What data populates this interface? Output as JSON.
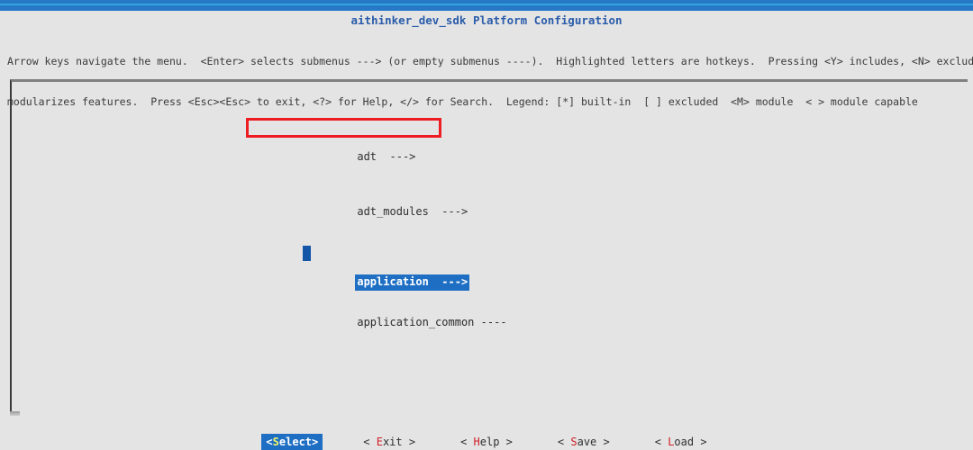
{
  "window": {
    "title": "aithinker_dev_sdk Platform Configuration",
    "top_bar_color": "#2878c8",
    "top_stripe_color": "#35a5dd",
    "background_color": "#e4e4e4",
    "title_color": "#2a5caa"
  },
  "help": {
    "line1": "Arrow keys navigate the menu.  <Enter> selects submenus ---> (or empty submenus ----).  Highlighted letters are hotkeys.  Pressing <Y> includes, <N> excludes, <M>",
    "line2": "modularizes features.  Press <Esc><Esc> to exit, <?> for Help, </> for Search.  Legend: [*] built-in  [ ] excluded  <M> module  < > module capable"
  },
  "menu": {
    "items": [
      {
        "label": "adt",
        "suffix": "--->",
        "selected": false
      },
      {
        "label": "adt_modules",
        "suffix": "--->",
        "selected": false
      },
      {
        "label": "application",
        "suffix": "--->",
        "selected": true,
        "hotkey": "a"
      },
      {
        "label": "application_common",
        "suffix": "----",
        "selected": false
      }
    ],
    "selected_index": 2,
    "highlight_color": "#1e6fc4",
    "cursor_color": "#1455a8",
    "hotkey_color": "#f3f36a"
  },
  "annotation": {
    "shape": "rectangle",
    "color": "#ee1c23",
    "targets": "application"
  },
  "buttons": [
    {
      "text_prefix": "<",
      "hotkey": "S",
      "rest": "elect>",
      "text_suffix": "",
      "active": true
    },
    {
      "text_prefix": "< ",
      "hotkey": "E",
      "rest": "xit",
      "text_suffix": " >",
      "active": false
    },
    {
      "text_prefix": "< ",
      "hotkey": "H",
      "rest": "elp",
      "text_suffix": " >",
      "active": false
    },
    {
      "text_prefix": "< ",
      "hotkey": "S",
      "rest": "ave",
      "text_suffix": " >",
      "active": false
    },
    {
      "text_prefix": "< ",
      "hotkey": "L",
      "rest": "oad",
      "text_suffix": " >",
      "active": false
    }
  ]
}
